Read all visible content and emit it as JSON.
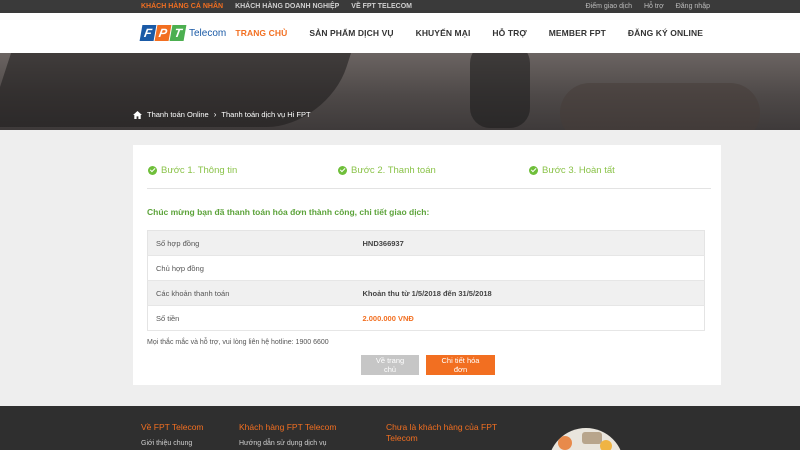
{
  "topbar": {
    "left": [
      "KHÁCH HÀNG CÁ NHÂN",
      "KHÁCH HÀNG DOANH NGHIỆP",
      "VỀ FPT TELECOM"
    ],
    "right": [
      "Điểm giao dịch",
      "Hỗ trợ",
      "Đăng nhập"
    ]
  },
  "logo": {
    "letters": [
      "F",
      "P",
      "T"
    ],
    "text": "Telecom",
    "colors": [
      "#1a5aa6",
      "#f26f21",
      "#4caf50"
    ]
  },
  "nav": [
    "TRANG CHỦ",
    "SẢN PHẨM DỊCH VỤ",
    "KHUYẾN MẠI",
    "HỖ TRỢ",
    "MEMBER FPT",
    "ĐĂNG KÝ ONLINE"
  ],
  "breadcrumb": [
    "Thanh toán Online",
    "Thanh toán dịch vụ Hi FPT"
  ],
  "steps": [
    "Bước 1. Thông tin",
    "Bước 2. Thanh toán",
    "Bước 3. Hoàn tất"
  ],
  "success_message": "Chúc mừng bạn đã thanh toán hóa đơn thành công, chi tiết giao dịch:",
  "details": [
    {
      "label": "Số hợp đồng",
      "value": "HND366937"
    },
    {
      "label": "Chủ hợp đồng",
      "value": ""
    },
    {
      "label": "Các khoản thanh toán",
      "value": "Khoản thu từ 1/5/2018 đến 31/5/2018"
    },
    {
      "label": "Số tiền",
      "value": "2.000.000 VNĐ"
    }
  ],
  "hotline": "Mọi thắc mắc và hỗ trợ, vui lòng liên hệ hotline: 1900 6600",
  "buttons": {
    "home": "Về trang chủ",
    "invoice": "Chi tiết hóa đơn"
  },
  "footer": {
    "col1": {
      "title": "Về FPT Telecom",
      "link": "Giới thiệu chung"
    },
    "col2": {
      "title": "Khách hàng FPT Telecom",
      "link": "Hướng dẫn sử dụng dịch vụ"
    },
    "col3": {
      "title": "Chưa là khách hàng của FPT Telecom"
    }
  },
  "colors": {
    "accent": "#f26f21",
    "success": "#6fbf3a",
    "brand_blue": "#1a5aa6"
  }
}
